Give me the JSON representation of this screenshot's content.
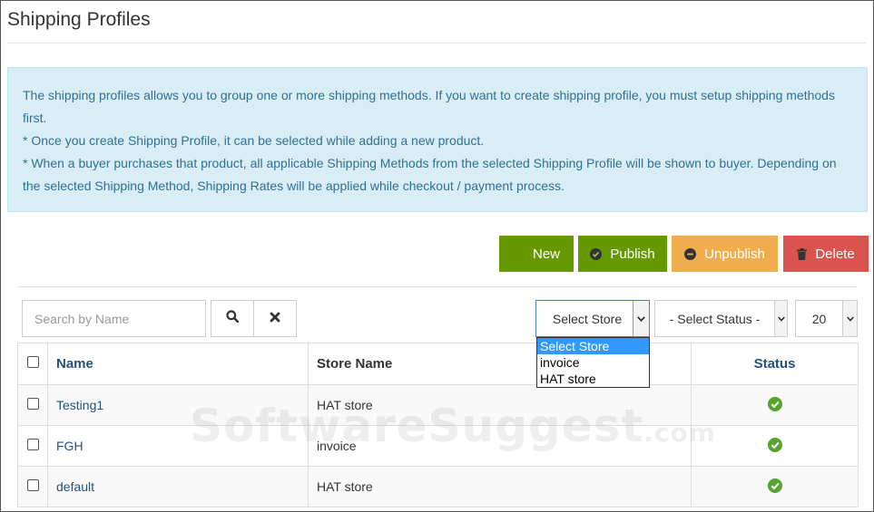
{
  "page": {
    "title": "Shipping Profiles"
  },
  "info": {
    "line1": "The shipping profiles allows you to group one or more shipping methods. If you want to create shipping profile, you must setup shipping methods first.",
    "line2": "* Once you create Shipping Profile, it can be selected while adding a new product.",
    "line3": "* When a buyer purchases that product, all applicable Shipping Methods from the selected Shipping Profile will be shown to buyer. Depending on the selected Shipping Method, Shipping Rates will be applied while checkout / payment process."
  },
  "toolbar": {
    "new_label": "New",
    "publish_label": "Publish",
    "unpublish_label": "Unpublish",
    "delete_label": "Delete"
  },
  "filters": {
    "search_placeholder": "Search by Name",
    "store_selected": "Select Store",
    "store_options": [
      "Select Store",
      "invoice",
      "HAT store"
    ],
    "status_selected": "- Select Status -",
    "page_size": "20"
  },
  "table": {
    "headers": {
      "name": "Name",
      "store": "Store Name",
      "status": "Status"
    },
    "rows": [
      {
        "name": "Testing1",
        "store": "HAT store"
      },
      {
        "name": "FGH",
        "store": "invoice"
      },
      {
        "name": "default",
        "store": "HAT store"
      }
    ]
  },
  "watermark": {
    "main": "SoftwareSuggest",
    "suffix": ".com"
  },
  "colors": {
    "green": "#669900",
    "orange": "#f0ad4e",
    "red": "#d9534f",
    "info_bg": "#d9edf7",
    "info_text": "#31708f",
    "link": "#23527c",
    "status_ok": "#55a52d"
  }
}
